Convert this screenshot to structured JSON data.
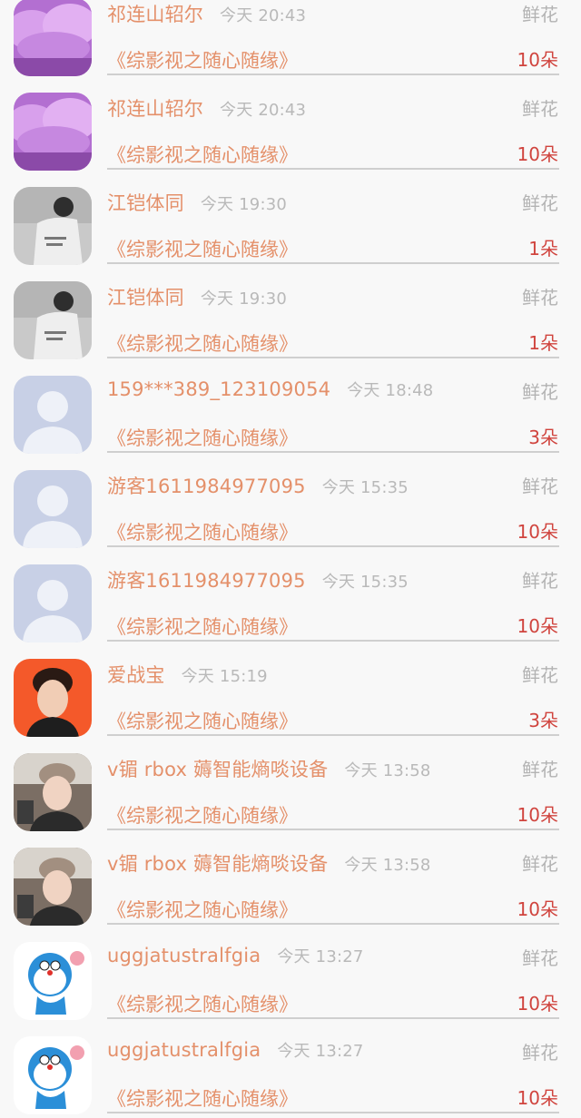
{
  "gift_list": [
    {
      "name": "祁连山轺尔",
      "time": "今天 20:43",
      "gift": "鲜花",
      "work": "《综影视之随心随缘》",
      "count": "10朵",
      "avatar": "purple-tree-avatar"
    },
    {
      "name": "祁连山轺尔",
      "time": "今天 20:43",
      "gift": "鲜花",
      "work": "《综影视之随心随缘》",
      "count": "10朵",
      "avatar": "purple-tree-avatar"
    },
    {
      "name": "江铠体同",
      "time": "今天 19:30",
      "gift": "鲜花",
      "work": "《综影视之随心随缘》",
      "count": "1朵",
      "avatar": "grayscale-person-avatar"
    },
    {
      "name": "江铠体同",
      "time": "今天 19:30",
      "gift": "鲜花",
      "work": "《综影视之随心随缘》",
      "count": "1朵",
      "avatar": "grayscale-person-avatar"
    },
    {
      "name": "159***389_123109054",
      "time": "今天 18:48",
      "gift": "鲜花",
      "work": "《综影视之随心随缘》",
      "count": "3朵",
      "avatar": "default-user-avatar"
    },
    {
      "name": "游客1611984977095",
      "time": "今天 15:35",
      "gift": "鲜花",
      "work": "《综影视之随心随缘》",
      "count": "10朵",
      "avatar": "default-user-avatar"
    },
    {
      "name": "游客1611984977095",
      "time": "今天 15:35",
      "gift": "鲜花",
      "work": "《综影视之随心随缘》",
      "count": "10朵",
      "avatar": "default-user-avatar"
    },
    {
      "name": "爱战宝",
      "time": "今天 15:19",
      "gift": "鲜花",
      "work": "《综影视之随心随缘》",
      "count": "3朵",
      "avatar": "orange-portrait-avatar"
    },
    {
      "name": "v镅 rbox 薅智能熵啖设备",
      "time": "今天 13:58",
      "gift": "鲜花",
      "work": "《综影视之随心随缘》",
      "count": "10朵",
      "avatar": "selfie-portrait-avatar"
    },
    {
      "name": "v镅 rbox 薅智能熵啖设备",
      "time": "今天 13:58",
      "gift": "鲜花",
      "work": "《综影视之随心随缘》",
      "count": "10朵",
      "avatar": "selfie-portrait-avatar"
    },
    {
      "name": "uggjatustralfgia",
      "time": "今天 13:27",
      "gift": "鲜花",
      "work": "《综影视之随心随缘》",
      "count": "10朵",
      "avatar": "doraemon-avatar"
    },
    {
      "name": "uggjatustralfgia",
      "time": "今天 13:27",
      "gift": "鲜花",
      "work": "《综影视之随心随缘》",
      "count": "10朵",
      "avatar": "doraemon-avatar"
    }
  ],
  "colors": {
    "name_text": "#e4906a",
    "time_text": "#b9b9b9",
    "gift_text": "#b3b3b3",
    "count_text": "#d0443e",
    "divider": "#cfcfcf",
    "background": "#f8f8f8"
  }
}
